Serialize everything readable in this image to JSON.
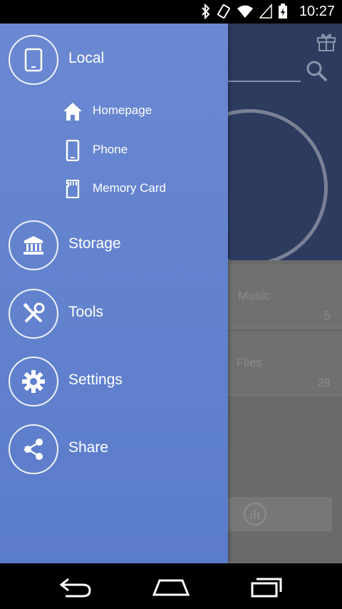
{
  "status_bar": {
    "time": "10:27"
  },
  "background": {
    "cards": [
      {
        "label": "Music",
        "count": "5"
      },
      {
        "label": "Files",
        "count": "28"
      }
    ]
  },
  "drawer": {
    "local": {
      "label": "Local",
      "icon": "tablet-icon"
    },
    "sub_items": [
      {
        "label": "Homepage",
        "icon": "home-icon"
      },
      {
        "label": "Phone",
        "icon": "phone-icon"
      },
      {
        "label": "Memory Card",
        "icon": "sd-card-icon"
      }
    ],
    "items": [
      {
        "label": "Storage",
        "icon": "bank-icon"
      },
      {
        "label": "Tools",
        "icon": "tools-icon"
      },
      {
        "label": "Settings",
        "icon": "gear-icon"
      },
      {
        "label": "Share",
        "icon": "share-icon"
      }
    ]
  },
  "colors": {
    "drawer": "#5f80cd",
    "header": "#2c3b5e"
  }
}
